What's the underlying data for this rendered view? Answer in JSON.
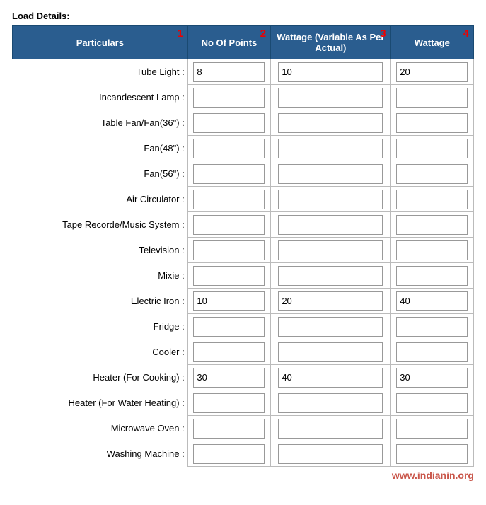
{
  "title": "Load Details:",
  "columns": [
    {
      "label": "Particulars",
      "num": "1"
    },
    {
      "label": "No Of Points",
      "num": "2"
    },
    {
      "label": "Wattage (Variable As Per Actual)",
      "num": "3"
    },
    {
      "label": "Wattage",
      "num": "4"
    }
  ],
  "rows": [
    {
      "label": "Tube Light :",
      "col1": "8",
      "col2": "10",
      "col3": "20"
    },
    {
      "label": "Incandescent Lamp :",
      "col1": "",
      "col2": "",
      "col3": ""
    },
    {
      "label": "Table Fan/Fan(36\") :",
      "col1": "",
      "col2": "",
      "col3": ""
    },
    {
      "label": "Fan(48\") :",
      "col1": "",
      "col2": "",
      "col3": ""
    },
    {
      "label": "Fan(56\") :",
      "col1": "",
      "col2": "",
      "col3": ""
    },
    {
      "label": "Air Circulator :",
      "col1": "",
      "col2": "",
      "col3": ""
    },
    {
      "label": "Tape Recorde/Music System :",
      "col1": "",
      "col2": "",
      "col3": ""
    },
    {
      "label": "Television :",
      "col1": "",
      "col2": "",
      "col3": ""
    },
    {
      "label": "Mixie :",
      "col1": "",
      "col2": "",
      "col3": ""
    },
    {
      "label": "Electric Iron :",
      "col1": "10",
      "col2": "20",
      "col3": "40"
    },
    {
      "label": "Fridge :",
      "col1": "",
      "col2": "",
      "col3": ""
    },
    {
      "label": "Cooler :",
      "col1": "",
      "col2": "",
      "col3": ""
    },
    {
      "label": "Heater (For Cooking) :",
      "col1": "30",
      "col2": "40",
      "col3": "30"
    },
    {
      "label": "Heater (For Water Heating) :",
      "col1": "",
      "col2": "",
      "col3": ""
    },
    {
      "label": "Microwave Oven :",
      "col1": "",
      "col2": "",
      "col3": ""
    },
    {
      "label": "Washing Machine :",
      "col1": "",
      "col2": "",
      "col3": ""
    }
  ],
  "watermark": "www.indianin.org"
}
